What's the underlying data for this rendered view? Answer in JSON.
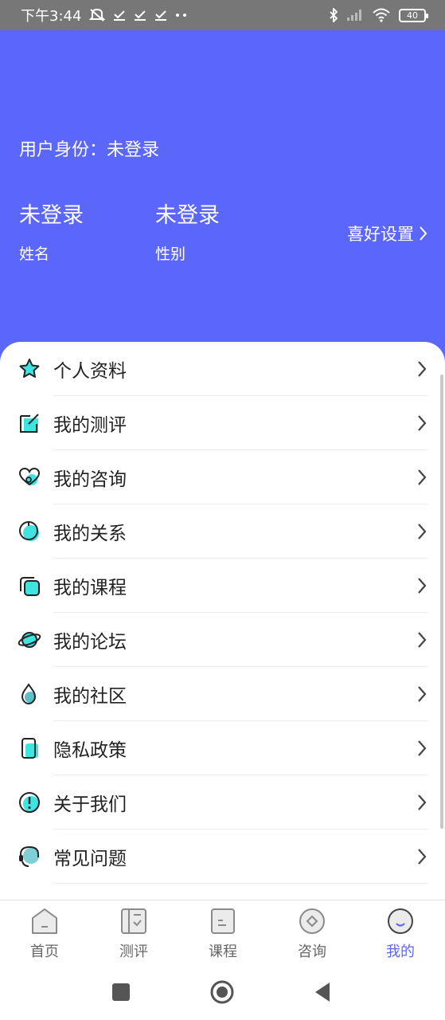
{
  "status_bar": {
    "time": "下午3:44",
    "battery": "40"
  },
  "header": {
    "identity": "用户身份：未登录",
    "name_value": "未登录",
    "name_label": "姓名",
    "gender_value": "未登录",
    "gender_label": "性别",
    "preference": "喜好设置"
  },
  "menu": {
    "items": [
      {
        "label": "个人资料",
        "icon": "star-icon"
      },
      {
        "label": "我的测评",
        "icon": "edit-square-icon"
      },
      {
        "label": "我的咨询",
        "icon": "heart-chat-icon"
      },
      {
        "label": "我的关系",
        "icon": "circle-icon"
      },
      {
        "label": "我的课程",
        "icon": "layers-icon"
      },
      {
        "label": "我的论坛",
        "icon": "planet-icon"
      },
      {
        "label": "我的社区",
        "icon": "drop-icon"
      },
      {
        "label": "隐私政策",
        "icon": "phone-icon"
      },
      {
        "label": "关于我们",
        "icon": "info-icon"
      },
      {
        "label": "常见问题",
        "icon": "headset-icon"
      }
    ]
  },
  "tabbar": {
    "tabs": [
      {
        "label": "首页",
        "icon": "home-icon"
      },
      {
        "label": "测评",
        "icon": "test-book-icon"
      },
      {
        "label": "课程",
        "icon": "course-doc-icon"
      },
      {
        "label": "咨询",
        "icon": "consult-icon"
      },
      {
        "label": "我的",
        "icon": "profile-icon"
      }
    ],
    "active_index": 4,
    "active_color": "#5B67FB"
  },
  "colors": {
    "header_bg": "#5B67FB",
    "icon_accent": "#3FE3E0"
  }
}
